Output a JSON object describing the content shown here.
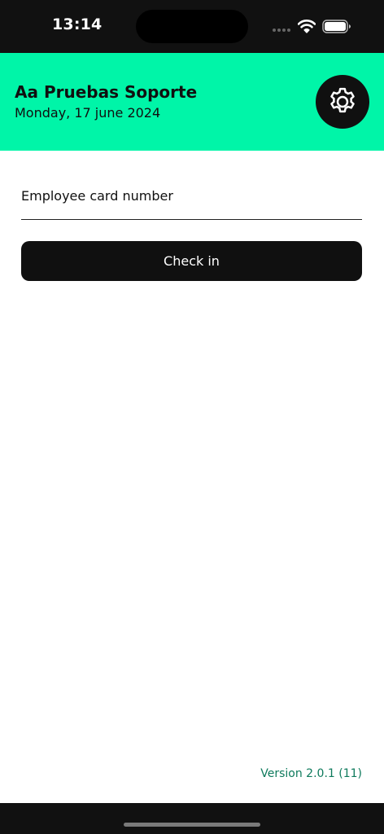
{
  "status_bar": {
    "time": "13:14",
    "icons": [
      "cellular-icon",
      "wifi-icon",
      "battery-icon"
    ]
  },
  "header": {
    "title": "Aa Pruebas Soporte",
    "date": "Monday, 17 june 2024",
    "settings_icon": "gear-icon",
    "background_color": "#00f5a8"
  },
  "form": {
    "card_number": {
      "value": "",
      "placeholder": "Employee card number"
    },
    "checkin_label": "Check in"
  },
  "footer": {
    "version": "Version 2.0.1 (11)",
    "version_color": "#0e7a5c"
  }
}
